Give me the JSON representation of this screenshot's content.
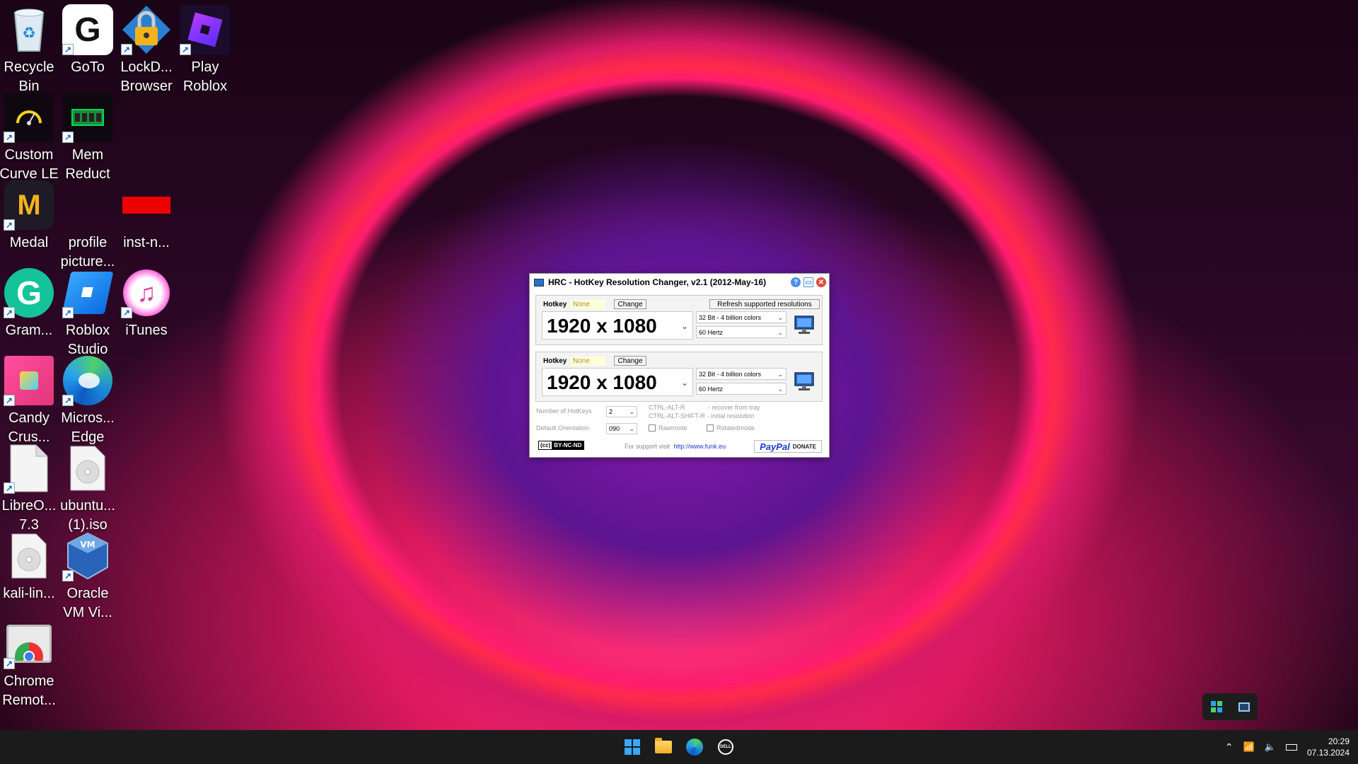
{
  "desktop": {
    "icons": [
      {
        "label": "Recycle Bin",
        "icon": "recycle-bin-icon"
      },
      {
        "label": "GoTo",
        "icon": "goto-icon"
      },
      {
        "label": "LockD... Browser",
        "icon": "lockdown-browser-icon"
      },
      {
        "label": "Play Roblox",
        "icon": "roblox-icon"
      },
      {
        "label": "Custom Curve LE",
        "icon": "speedometer-icon"
      },
      {
        "label": "Mem Reduct",
        "icon": "memory-icon"
      },
      {
        "label": "Medal",
        "icon": "medal-icon"
      },
      {
        "label": "profile picture...",
        "icon": "image-file-icon"
      },
      {
        "label": "inst-n...",
        "icon": "image-file-icon"
      },
      {
        "label": "Gram...",
        "icon": "grammarly-icon"
      },
      {
        "label": "Roblox Studio",
        "icon": "roblox-studio-icon"
      },
      {
        "label": "iTunes",
        "icon": "itunes-icon"
      },
      {
        "label": "Candy Crus...",
        "icon": "candy-crush-icon"
      },
      {
        "label": "Micros... Edge",
        "icon": "edge-icon"
      },
      {
        "label": "LibreO... 7.3",
        "icon": "document-icon"
      },
      {
        "label": "ubuntu... (1).iso",
        "icon": "disc-image-icon"
      },
      {
        "label": "kali-lin...",
        "icon": "disc-image-icon"
      },
      {
        "label": "Oracle VM Vi...",
        "icon": "virtualbox-icon"
      },
      {
        "label": "Chrome Remot...",
        "icon": "chrome-remote-icon"
      }
    ]
  },
  "dialog": {
    "title": "HRC - HotKey Resolution Changer, v2.1 (2012-May-16)",
    "groups": [
      {
        "hotkey_label": "Hotkey",
        "hotkey_value": "None",
        "change_label": "Change",
        "resolution": "1920 x 1080",
        "color_depth": "32 Bit - 4 billion colors",
        "refresh": "60 Hertz"
      },
      {
        "hotkey_label": "Hotkey",
        "hotkey_value": "None",
        "change_label": "Change",
        "resolution": "1920 x 1080",
        "color_depth": "32 Bit - 4 billion colors",
        "refresh": "60 Hertz"
      }
    ],
    "refresh_button": "Refresh supported resolutions",
    "num_hotkeys_label": "Number of HotKeys",
    "num_hotkeys_value": "2",
    "orientation_label": "Default Orientation",
    "orientation_value": "090",
    "shortcut_1": "CTRL-ALT-R",
    "shortcut_1_desc": "- recover from tray",
    "shortcut_2": "CTRL-ALT-SHIFT-R - initial resolution",
    "rawmode_label": "Rawmode",
    "rotatedmode_label": "Rotatedmode",
    "license_badge": "BY-NC-ND",
    "support_text": "For support visit",
    "support_link": "http://www.funk.eu",
    "paypal_label": "PayPal",
    "donate_label": "DONATE"
  },
  "taskbar": {
    "time": "20:29",
    "date": "07.13.2024"
  },
  "colors": {
    "taskbar_bg": "#1b1b1b",
    "link": "#1a3ccc",
    "accent_blue": "#1560d8"
  }
}
